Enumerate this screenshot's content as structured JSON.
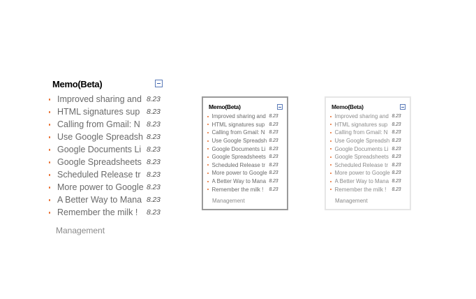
{
  "widget": {
    "title": "Memo(Beta)",
    "collapse_icon": "minus-icon",
    "footer": "Management",
    "items": [
      {
        "text": "Improved sharing and",
        "date": "8.23"
      },
      {
        "text": "HTML signatures sup",
        "date": "8.23"
      },
      {
        "text": "Calling from Gmail: N",
        "date": "8.23"
      },
      {
        "text": "Use Google Spreadsh",
        "date": "8.23"
      },
      {
        "text": "Google Documents Li",
        "date": "8.23"
      },
      {
        "text": "Google Spreadsheets",
        "date": "8.23"
      },
      {
        "text": "Scheduled Release tr",
        "date": "8.23"
      },
      {
        "text": "More power to Google",
        "date": "8.23"
      },
      {
        "text": "A Better Way to Mana",
        "date": "8.23"
      },
      {
        "text": "Remember the milk !",
        "date": "8.23"
      }
    ]
  },
  "colors": {
    "bullet": "#e86a2a",
    "collapse_border": "#5a7ab8",
    "med_border": "#9a9a9a",
    "small_border": "#e6e6e6"
  }
}
